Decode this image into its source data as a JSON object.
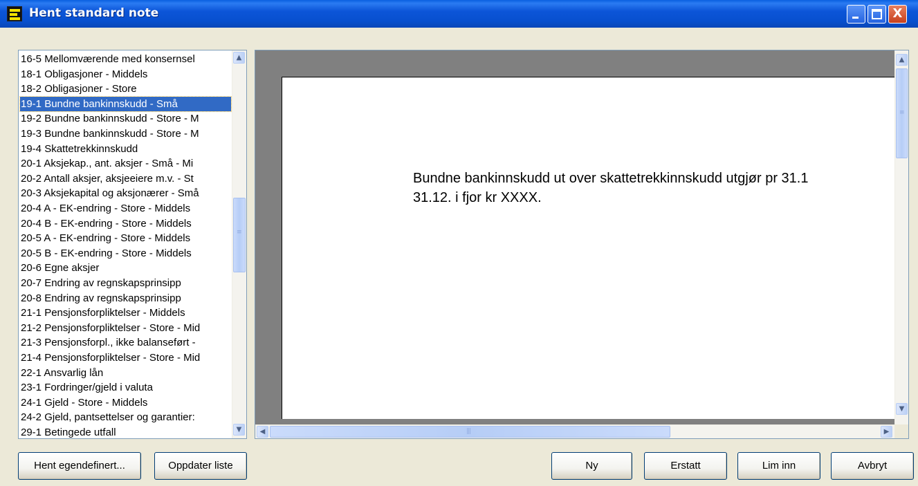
{
  "window": {
    "title": "Hent standard note",
    "controls": {
      "minimize_icon": "minimize-icon",
      "maximize_icon": "maximize-icon",
      "close_label": "X"
    }
  },
  "notes_list": {
    "items": [
      "16-5 Mellomværende med konsernsel",
      "18-1 Obligasjoner - Middels",
      "18-2 Obligasjoner - Store",
      "19-1 Bundne bankinnskudd - Små",
      "19-2 Bundne bankinnskudd - Store - M",
      "19-3 Bundne bankinnskudd - Store - M",
      "19-4 Skattetrekkinnskudd",
      "20-1 Aksjekap., ant. aksjer - Små - Mi",
      "20-2 Antall aksjer, aksjeeiere m.v. - St",
      "20-3 Aksjekapital og aksjonærer - Små",
      "20-4 A - EK-endring - Store - Middels",
      "20-4 B - EK-endring - Store - Middels",
      "20-5 A - EK-endring - Store - Middels",
      "20-5 B - EK-endring - Store - Middels",
      "20-6 Egne aksjer",
      "20-7 Endring av regnskapsprinsipp",
      "20-8 Endring av regnskapsprinsipp",
      "21-1 Pensjonsforpliktelser - Middels",
      "21-2 Pensjonsforpliktelser - Store - Mid",
      "21-3 Pensjonsforpl., ikke balanseført -",
      "21-4 Pensjonsforpliktelser - Store - Mid",
      "22-1 Ansvarlig lån",
      "23-1 Fordringer/gjeld i valuta",
      "24-1 Gjeld - Store - Middels",
      "24-2 Gjeld, pantsettelser og garantier:",
      "29-1 Betingede utfall"
    ],
    "selected_index": 3
  },
  "preview": {
    "lines": [
      "Bundne bankinnskudd ut over skattetrekkinnskudd utgjør pr 31.1",
      "31.12. i fjor kr XXXX."
    ]
  },
  "buttons": {
    "hent_egendefinert": "Hent egendefinert...",
    "oppdater_liste": "Oppdater liste",
    "ny": "Ny",
    "erstatt": "Erstatt",
    "lim_inn": "Lim inn",
    "avbryt": "Avbryt"
  },
  "icons": {
    "scroll_up": "scroll-up-icon",
    "scroll_down": "scroll-down-icon",
    "scroll_left": "scroll-left-icon",
    "scroll_right": "scroll-right-icon"
  },
  "colors": {
    "titlebar": "#0a55d8",
    "selection": "#316ac5",
    "dialog_bg": "#ece9d8",
    "preview_bg": "#808080"
  }
}
